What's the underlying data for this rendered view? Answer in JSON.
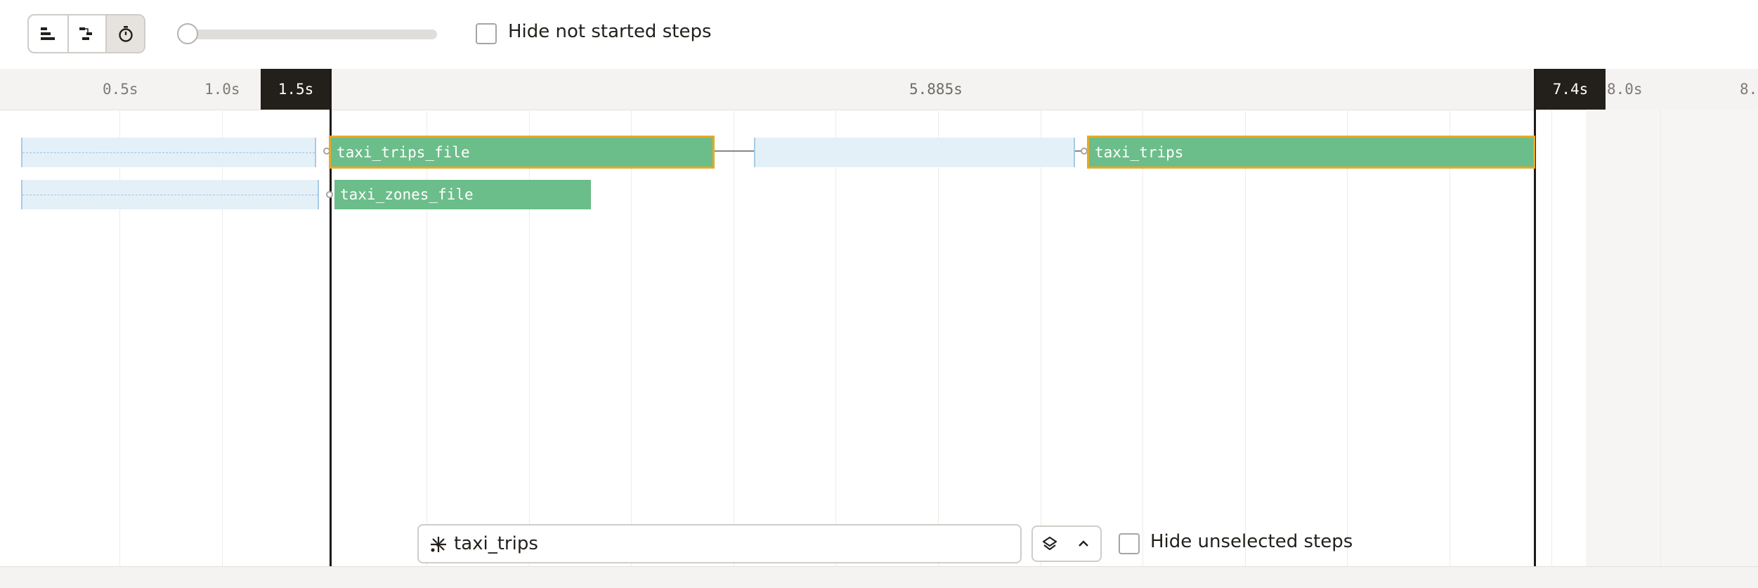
{
  "toolbar": {
    "view_modes": [
      {
        "name": "flat",
        "icon": "flat-list-icon",
        "active": false
      },
      {
        "name": "waterfall",
        "icon": "waterfall-icon",
        "active": false
      },
      {
        "name": "timed",
        "icon": "stopwatch-icon",
        "active": true
      }
    ],
    "zoom_slider_value": 0,
    "hide_not_started_label": "Hide not started steps",
    "hide_not_started_checked": false
  },
  "timeline": {
    "ticks": [
      "0.5s",
      "1.0s",
      "8.0s",
      "8."
    ],
    "range_start_label": "1.5s",
    "range_span_label": "5.885s",
    "range_end_label": "7.4s"
  },
  "steps": [
    {
      "name": "taxi_trips_file",
      "status": "succeeded",
      "selected": true
    },
    {
      "name": "taxi_zones_file",
      "status": "succeeded",
      "selected": false
    },
    {
      "name": "taxi_trips",
      "status": "succeeded",
      "selected": true
    }
  ],
  "query": {
    "value": "taxi_trips",
    "icon": "selection-query-icon",
    "hide_unselected_label": "Hide unselected steps",
    "hide_unselected_checked": false
  },
  "colors": {
    "success": "#6bbd8a",
    "selected_border": "#e8a928",
    "waiting": "#e4f0f8",
    "marker": "#231f1b"
  }
}
